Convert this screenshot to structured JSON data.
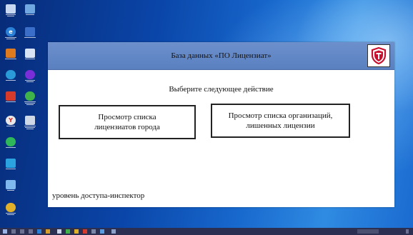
{
  "app": {
    "title": "База данных «ПО Лицензиат»",
    "prompt": "Выберите следующее действие",
    "buttons": {
      "licensees_line1": "Просмотр списка",
      "licensees_line2": "лицензиатов города",
      "revoked_line1": "Просмотр списка организаций,",
      "revoked_line2": "лишенных лицензии"
    },
    "access_level": "уровень доступа-инспектор"
  },
  "desktop": {
    "icons": [
      {
        "name": "recycle-bin-icon",
        "color": "#c8d8f0"
      },
      {
        "name": "this-pc-icon",
        "color": "#6fa7e0"
      },
      {
        "name": "edge-icon",
        "color": "#2a7fd6"
      },
      {
        "name": "printer-icon",
        "color": "#3b6ec8"
      },
      {
        "name": "program-icon",
        "color": "#e07a1f"
      },
      {
        "name": "app-icon",
        "color": "#d8e4f5"
      },
      {
        "name": "settings-icon",
        "color": "#2a9ad8"
      },
      {
        "name": "browser-icon",
        "color": "#7a2ed8"
      },
      {
        "name": "presentation-icon",
        "color": "#d63a2a"
      },
      {
        "name": "search-app-icon",
        "color": "#3fb34a"
      },
      {
        "name": "yandex-icon",
        "color": "#e8e8e8"
      },
      {
        "name": "document-icon",
        "color": "#cfd8e6"
      },
      {
        "name": "whatsapp-icon",
        "color": "#2fb85a"
      },
      {
        "name": "telegram-icon",
        "color": "#2aa3e0"
      },
      {
        "name": "window-app-icon",
        "color": "#7fb8ee"
      },
      {
        "name": "chrome-icon",
        "color": "#e0b02a"
      }
    ],
    "colors": {
      "titlebar": "#5f84c4",
      "taskbar": "#2b2f52"
    }
  }
}
